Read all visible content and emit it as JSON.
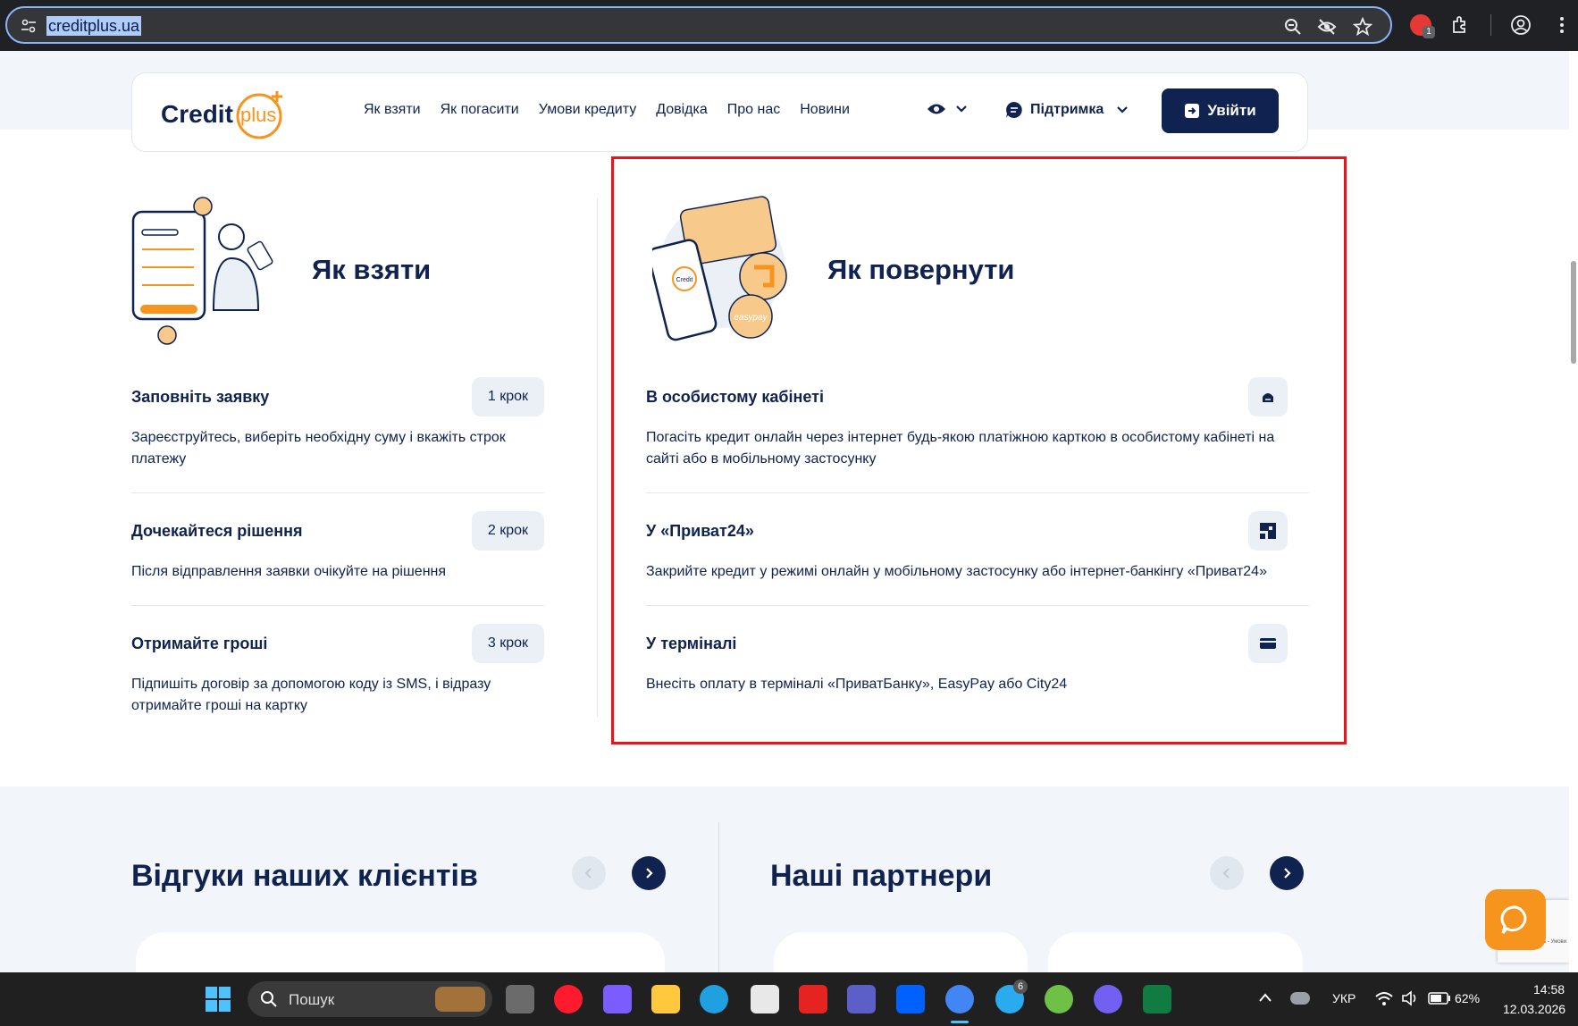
{
  "browser": {
    "url": "creditplus.ua",
    "ext_badge": "1"
  },
  "header": {
    "logo_text": "Credit",
    "logo_plus": "plus",
    "nav": [
      "Як взяти",
      "Як погасити",
      "Умови кредиту",
      "Довідка",
      "Про нас",
      "Новини"
    ],
    "support_label": "Підтримка",
    "login_label": "Увійти"
  },
  "how_to_take": {
    "title": "Як взяти",
    "steps": [
      {
        "title": "Заповніть заявку",
        "badge": "1 крок",
        "desc": "Зареєструйтесь, виберіть необхідну суму і вкажіть строк платежу"
      },
      {
        "title": "Дочекайтеся рішення",
        "badge": "2 крок",
        "desc": "Після відправлення заявки очікуйте на рішення"
      },
      {
        "title": "Отримайте гроші",
        "badge": "3 крок",
        "desc": "Підпишіть договір за допомогою коду із SMS, і відразу отримайте гроші на картку"
      }
    ]
  },
  "how_to_repay": {
    "title": "Як повернути",
    "methods": [
      {
        "title": "В особистому кабінеті",
        "icon": "cabinet-icon",
        "desc": "Погасіть кредит онлайн через інтернет будь-якою платіжною карткою в особистому кабінеті на сайті або в мобільному застосунку"
      },
      {
        "title": "У «Приват24»",
        "icon": "privat24-icon",
        "desc": "Закрийте кредит у режимі онлайн у мобільному застосунку або інтернет-банкінгу «Приват24»"
      },
      {
        "title": "У терміналі",
        "icon": "terminal-card-icon",
        "desc": "Внесіть оплату в терміналі «ПриватБанку», EasyPay або City24"
      }
    ]
  },
  "illustration": {
    "phone_label": "Credit",
    "easypay_label": "easypay"
  },
  "reviews": {
    "title": "Відгуки наших клієнтів"
  },
  "partners": {
    "title": "Наші партнери"
  },
  "recaptcha": {
    "text": "Конфіденційність - Умови використання"
  },
  "taskbar": {
    "search_placeholder": "Пошук",
    "telegram_badge": "6",
    "language": "УКР",
    "battery": "62%",
    "time": "14:58",
    "date": "12.03.2026"
  },
  "colors": {
    "navy": "#0f2250",
    "orange": "#f7941d",
    "highlight": "#e8161c",
    "light_bg": "#f2f6fa"
  }
}
